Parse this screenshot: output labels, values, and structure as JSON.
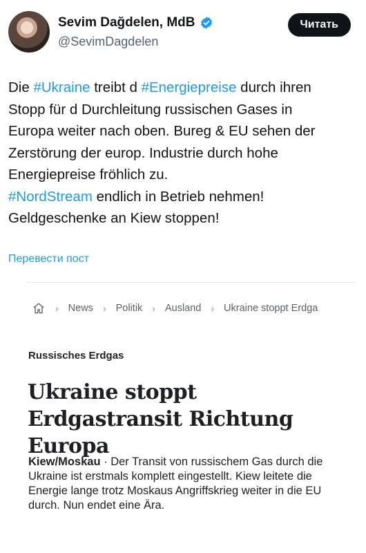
{
  "author": {
    "name": "Sevim Dağdelen, MdB",
    "handle": "@SevimDagdelen",
    "verified": true
  },
  "follow_button": {
    "label": "Читать"
  },
  "tweet": {
    "lines": [
      [
        {
          "t": "Die ",
          "tag": false
        },
        {
          "t": "#Ukraine",
          "tag": true
        },
        {
          "t": " treibt d ",
          "tag": false
        },
        {
          "t": "#Energiepreise",
          "tag": true
        },
        {
          "t": " durch ihren",
          "tag": false
        }
      ],
      [
        {
          "t": "Stopp für d Durchleitung russischen Gases in",
          "tag": false
        }
      ],
      [
        {
          "t": "Europa weiter nach oben. Bureg & EU sehen der",
          "tag": false
        }
      ],
      [
        {
          "t": "Zerstörung der europ. Industrie durch hohe",
          "tag": false
        }
      ],
      [
        {
          "t": "Energiepreise fröhlich zu.",
          "tag": false
        }
      ],
      [
        {
          "t": "#NordStream",
          "tag": true
        },
        {
          "t": " endlich in Betrieb nehmen!",
          "tag": false
        }
      ],
      [
        {
          "t": "Geldgeschenke an Kiew stoppen!",
          "tag": false
        }
      ]
    ],
    "translate_link": "Перевести пост"
  },
  "article": {
    "breadcrumb": [
      "News",
      "Politik",
      "Ausland",
      "Ukraine stoppt Erdga"
    ],
    "kicker": "Russisches Erdgas",
    "headline": "Ukraine stoppt Erdgastransit Richtung Europa",
    "lead_place": "Kiew/Moskau",
    "lead_separator": " · ",
    "lead_text": "Der Transit von russischem Gas durch die Ukraine ist erstmals komplett eingestellt. Kiew leitete die Energie lange trotz Moskaus Angriffskrieg weiter in die EU durch. Nun endet eine Ära."
  },
  "colors": {
    "link": "#1d9bf0",
    "text": "#0f1419",
    "muted": "#536471",
    "button_bg": "#0f1419"
  },
  "icons": [
    "verified-badge-icon",
    "home-icon",
    "chevron-right-icon"
  ]
}
